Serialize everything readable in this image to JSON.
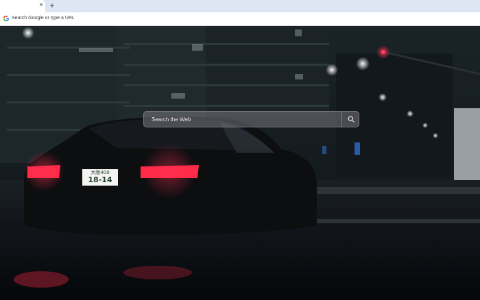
{
  "browser": {
    "tab": {
      "close_glyph": "×"
    },
    "new_tab_glyph": "+",
    "omnibox": {
      "placeholder": "Search Google or type a URL",
      "icon": "google-g-icon"
    }
  },
  "newtab_page": {
    "background": "night street with dark car and red tail lights",
    "search": {
      "placeholder": "Search the Web",
      "icon": "search-icon"
    },
    "plate": {
      "line1": "大阪400",
      "line2": "18-14"
    },
    "colors": {
      "tabstrip": "#dfe6f3",
      "search_bg": "#78787f",
      "tail_light": "#ff2a48"
    }
  }
}
